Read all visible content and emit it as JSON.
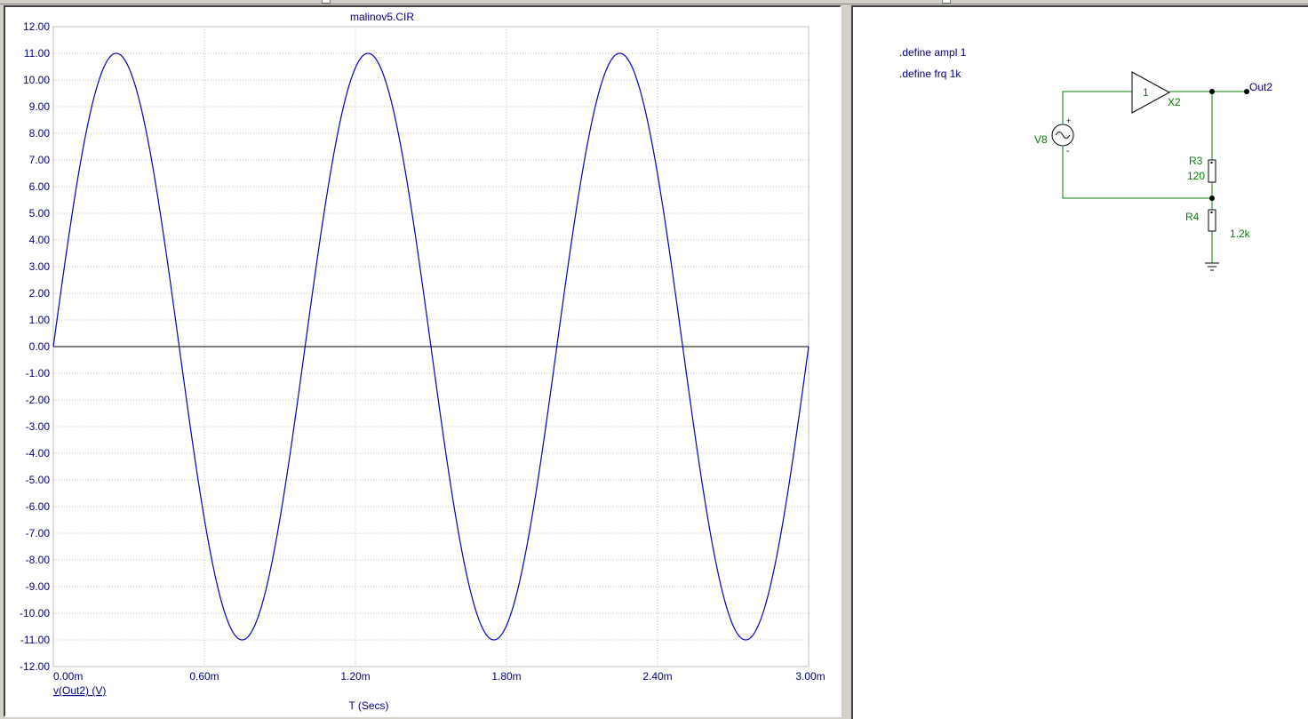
{
  "plot": {
    "title": "malinov5.CIR",
    "trace_label": "v(Out2) (V)",
    "x_axis_label": "T (Secs)",
    "trace_color": "#0000c0",
    "grid_color": "#c0c0c0",
    "text_color": "#000080"
  },
  "chart_data": {
    "type": "line",
    "title": "malinov5.CIR",
    "xlabel": "T (Secs)",
    "ylabel": "",
    "xlim": [
      0,
      0.003
    ],
    "ylim": [
      -12,
      12
    ],
    "grid": true,
    "y_ticks": [
      "12.00",
      "11.00",
      "10.00",
      "9.00",
      "8.00",
      "7.00",
      "6.00",
      "5.00",
      "4.00",
      "3.00",
      "2.00",
      "1.00",
      "0.00",
      "-1.00",
      "-2.00",
      "-3.00",
      "-4.00",
      "-5.00",
      "-6.00",
      "-7.00",
      "-8.00",
      "-9.00",
      "-10.00",
      "-11.00",
      "-12.00"
    ],
    "x_ticks": [
      "0.00m",
      "0.60m",
      "1.20m",
      "1.80m",
      "2.40m",
      "3.00m"
    ],
    "series": [
      {
        "name": "v(Out2) (V)",
        "color": "#0000c0",
        "amplitude": 11,
        "frequency_hz": 1000,
        "offset": 0,
        "waveform": "sine"
      }
    ]
  },
  "schematic": {
    "directives": [
      ".define ampl 1",
      ".define frq 1k"
    ],
    "amplifier_gain": "1",
    "amplifier_name": "X2",
    "output_node": "Out2",
    "source_name": "V8",
    "source_plus": "+",
    "source_minus": "-",
    "r3_name": "R3",
    "r3_value": "120",
    "r4_name": "R4",
    "r4_value": "1.2k",
    "wire_color": "#008000",
    "label_color": "#000080",
    "part_label_color": "#008000"
  }
}
